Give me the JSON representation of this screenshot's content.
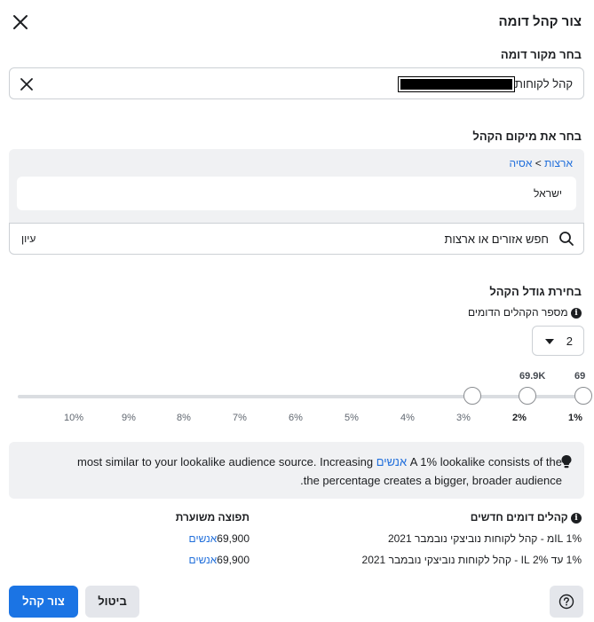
{
  "dialog": {
    "title": "צור קהל דומה"
  },
  "source": {
    "label": "בחר מקור דומה",
    "value": "קהל לקוחות"
  },
  "location": {
    "label": "בחר את מיקום הקהל",
    "breadcrumb_root": "ארצות",
    "breadcrumb_separator": ">",
    "breadcrumb_child": "אסיה",
    "selected_country": "ישראל",
    "search_placeholder": "חפש אזורים או ארצות",
    "browse_label": "עיון"
  },
  "size": {
    "label": "בחירת גודל הקהל",
    "count_label": "מספר הקהלים הדומים",
    "count_value": "2",
    "slider_values": [
      "69",
      "69.9K"
    ],
    "ticks": [
      "1%",
      "2%",
      "3%",
      "4%",
      "5%",
      "6%",
      "7%",
      "8%",
      "9%",
      "10%"
    ],
    "active_ticks": [
      "1%",
      "2%"
    ]
  },
  "note": {
    "line1_prefix": "A 1% lookalike consists of the ",
    "line1_link": "אנשים",
    "line1_suffix": " most similar to your lookalike audience source. Increasing",
    "line2": "the percentage creates a bigger, broader audience."
  },
  "table": {
    "col_audiences": "קהלים דומים חדשים",
    "col_reach": "תפוצה משוערת",
    "rows": [
      {
        "name": "1% ILמ - קהל לקוחות נוביצקי נובמבר 2021",
        "reach_number": "69,900",
        "reach_unit": "אנשים"
      },
      {
        "name": "1% עד 2% IL - קהל לקוחות נוביצקי נובמבר 2021",
        "reach_number": "69,900",
        "reach_unit": "אנשים"
      }
    ]
  },
  "footer": {
    "create_label": "צור קהל",
    "cancel_label": "ביטול"
  },
  "colors": {
    "accent": "#1b74e4",
    "link": "#216fdb",
    "panel_bg": "#f0f1f3"
  },
  "icons": [
    "close-icon",
    "clear-icon",
    "search-icon",
    "info-icon",
    "caret-down-icon",
    "lightbulb-icon",
    "help-icon"
  ]
}
